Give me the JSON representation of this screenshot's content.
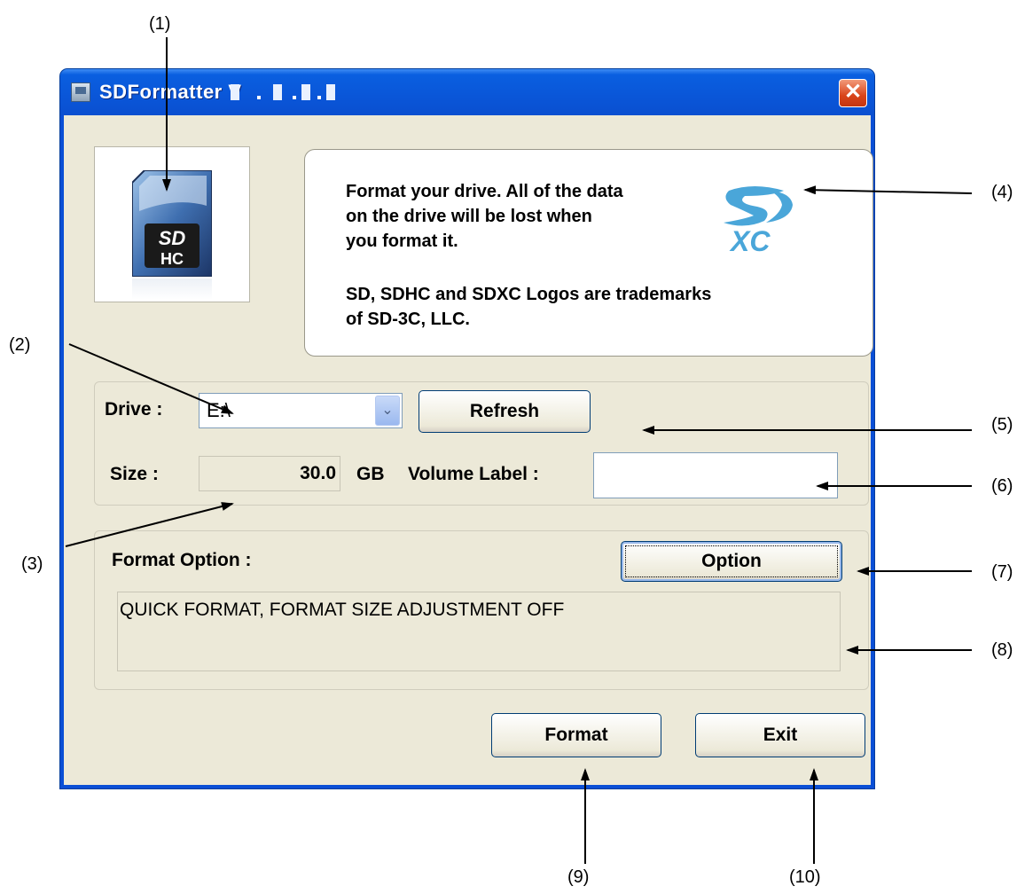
{
  "callouts": [
    "(1)",
    "(2)",
    "(3)",
    "(4)",
    "(5)",
    "(6)",
    "(7)",
    "(8)",
    "(9)",
    "(10)"
  ],
  "window": {
    "title": "SDFormatter V",
    "close_label": "✕"
  },
  "info": {
    "line1": "Format your drive. All of the data",
    "line2": "on the drive will be lost when",
    "line3": "you format it.",
    "line4": "SD, SDHC and SDXC Logos are trademarks",
    "line5": "of SD-3C, LLC."
  },
  "drive": {
    "label": "Drive :",
    "value": "E:\\",
    "dropdown_icon": "chevron-down-icon",
    "refresh_label": "Refresh"
  },
  "size": {
    "label": "Size :",
    "value": "30.0",
    "unit": "GB"
  },
  "volume": {
    "label": "Volume Label :",
    "value": ""
  },
  "format_option": {
    "label": "Format Option :",
    "option_button": "Option",
    "current": "QUICK FORMAT, FORMAT SIZE ADJUSTMENT OFF"
  },
  "actions": {
    "format_label": "Format",
    "exit_label": "Exit"
  },
  "colors": {
    "titlebar": "#0a56d8",
    "dialog_bg": "#ece9d8",
    "close_button": "#d9441a"
  }
}
